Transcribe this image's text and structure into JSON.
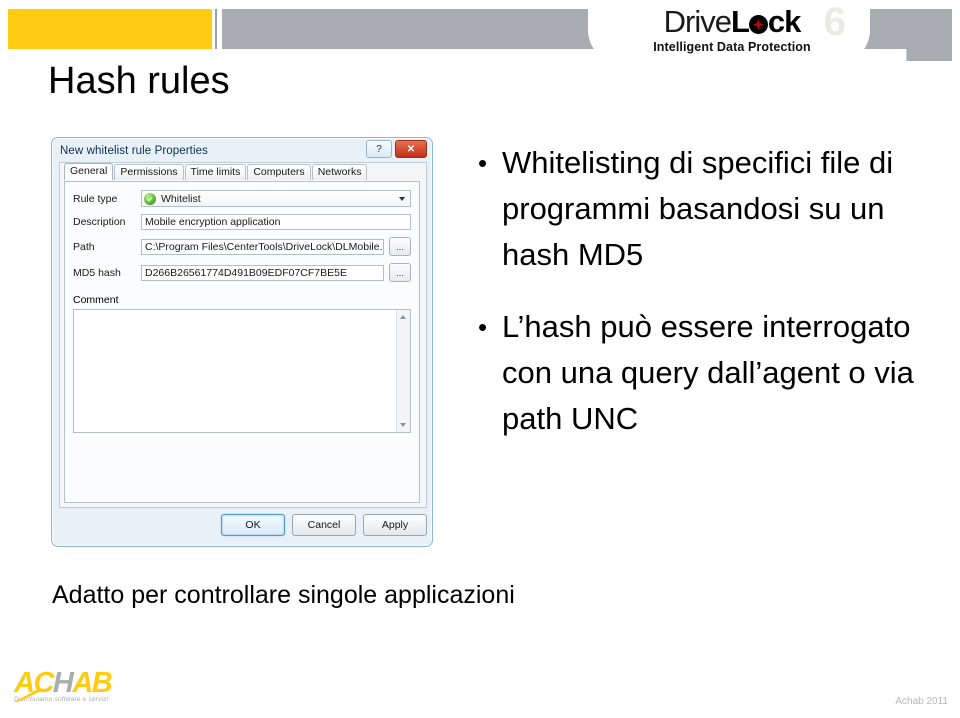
{
  "brand": {
    "logo_drive": "Drive",
    "logo_l": "L",
    "logo_ck": "ck",
    "logo_version": "6",
    "logo_tagline": "Intelligent Data Protection",
    "lock_icon_name": "lock-icon",
    "yellow": "#FFCC11",
    "gray": "#A9ACB0",
    "red": "#CC0000"
  },
  "slide": {
    "title": "Hash rules",
    "closing_line": "Adatto per controllare singole applicazioni",
    "bullets": [
      "Whitelisting di specifici file di programmi basandosi su un hash MD5",
      "L’hash può essere interrogato con una query dall’agent o via path UNC"
    ],
    "bullet_marker": "•"
  },
  "dialog": {
    "title": "New whitelist rule Properties",
    "help_button": "?",
    "close_button": "✕",
    "tabs": [
      {
        "label": "General",
        "active": true
      },
      {
        "label": "Permissions",
        "active": false
      },
      {
        "label": "Time limits",
        "active": false
      },
      {
        "label": "Computers",
        "active": false
      },
      {
        "label": "Networks",
        "active": false
      }
    ],
    "fields": {
      "rule_type_label": "Rule type",
      "rule_type_value": "Whitelist",
      "rule_type_icon": "green-check-icon",
      "description_label": "Description",
      "description_value": "Mobile encryption application",
      "path_label": "Path",
      "path_value": "C:\\Program Files\\CenterTools\\DriveLock\\DLMobile.ex",
      "md5_label": "MD5 hash",
      "md5_value": "D266B26561774D491B09EDF07CF7BE5E",
      "browse_label": "...",
      "comment_label": "Comment",
      "comment_value": ""
    },
    "buttons": {
      "ok": "OK",
      "cancel": "Cancel",
      "apply": "Apply"
    }
  },
  "footer": {
    "achab_ac": "AC",
    "achab_h": "H",
    "achab_ab": "AB",
    "achab_tagline": "Distribuiamo software e servizi",
    "credit": "Achab 2011"
  }
}
